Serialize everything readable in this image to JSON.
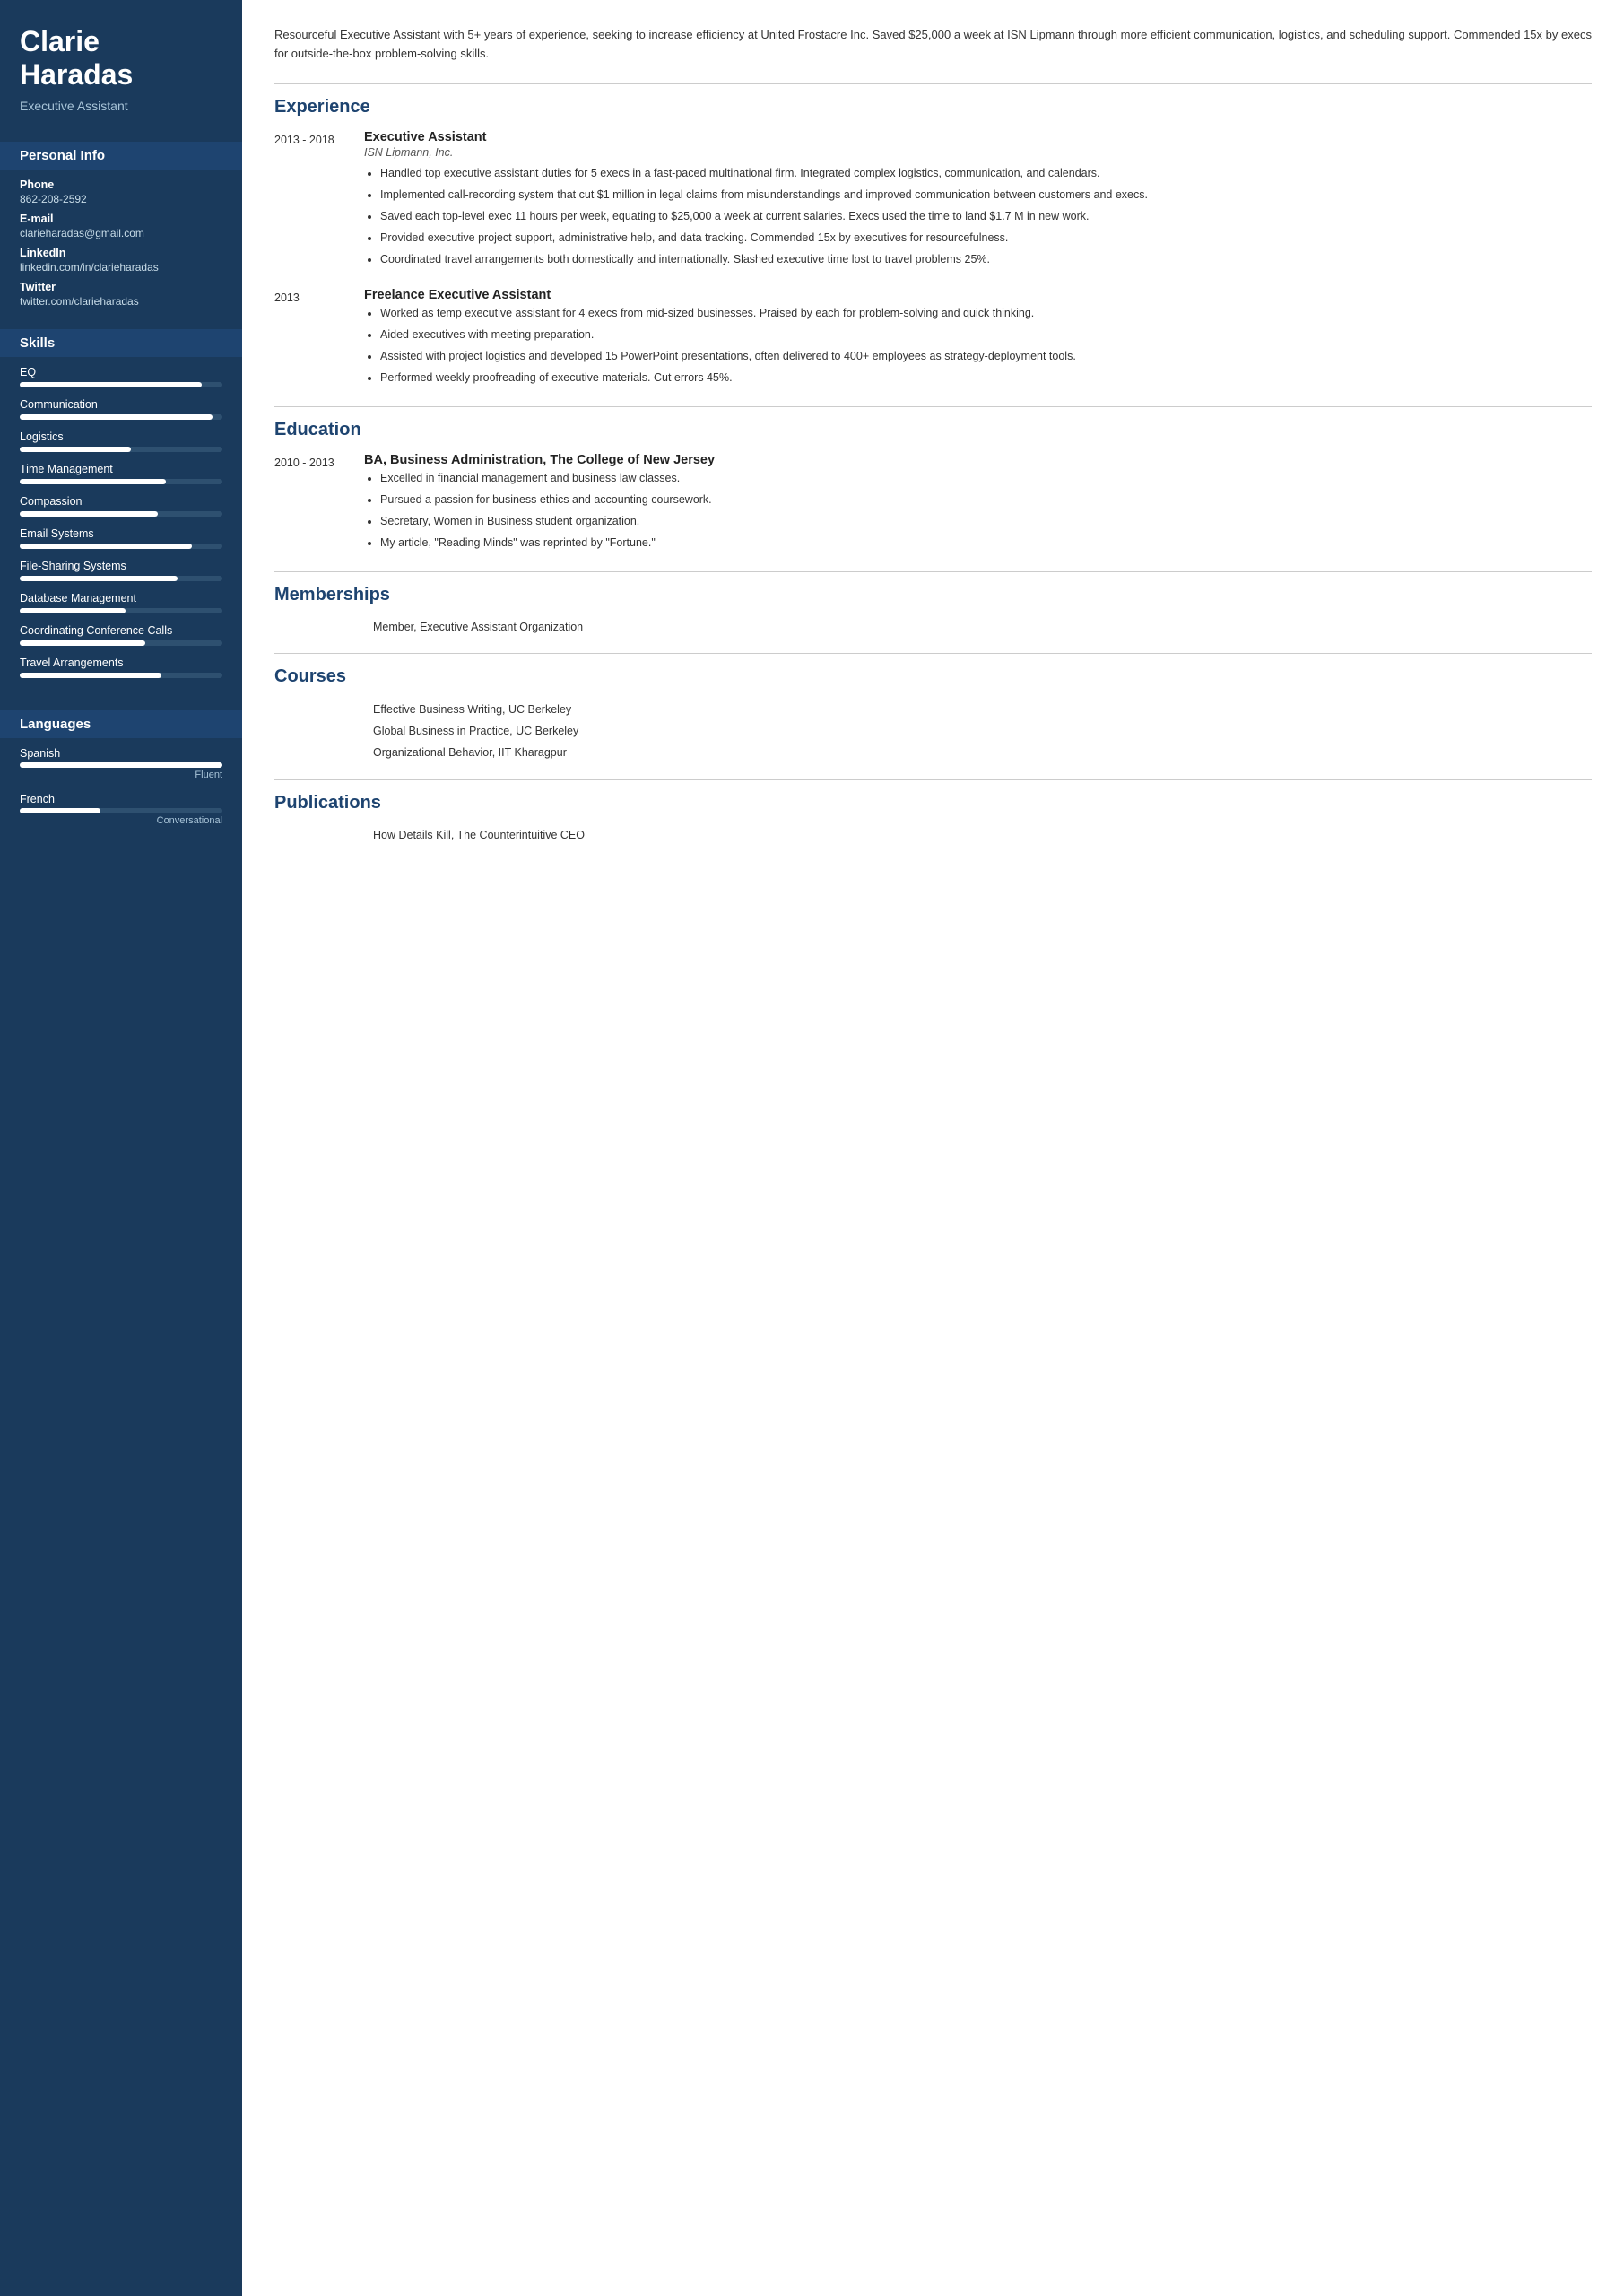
{
  "sidebar": {
    "name_line1": "Clarie",
    "name_line2": "Haradas",
    "title": "Executive Assistant",
    "sections": {
      "personal_info": {
        "label": "Personal Info",
        "fields": [
          {
            "label": "Phone",
            "value": "862-208-2592"
          },
          {
            "label": "E-mail",
            "value": "clarieharadas@gmail.com"
          },
          {
            "label": "LinkedIn",
            "value": "linkedin.com/in/clarieharadas"
          },
          {
            "label": "Twitter",
            "value": "twitter.com/clarieharadas"
          }
        ]
      },
      "skills": {
        "label": "Skills",
        "items": [
          {
            "name": "EQ",
            "percent": 90
          },
          {
            "name": "Communication",
            "percent": 95
          },
          {
            "name": "Logistics",
            "percent": 55
          },
          {
            "name": "Time Management",
            "percent": 72
          },
          {
            "name": "Compassion",
            "percent": 68
          },
          {
            "name": "Email Systems",
            "percent": 85
          },
          {
            "name": "File-Sharing Systems",
            "percent": 78
          },
          {
            "name": "Database Management",
            "percent": 52
          },
          {
            "name": "Coordinating Conference Calls",
            "percent": 62
          },
          {
            "name": "Travel Arrangements",
            "percent": 70
          }
        ]
      },
      "languages": {
        "label": "Languages",
        "items": [
          {
            "name": "Spanish",
            "percent": 100,
            "level": "Fluent"
          },
          {
            "name": "French",
            "percent": 40,
            "level": "Conversational"
          }
        ]
      }
    }
  },
  "main": {
    "summary": "Resourceful Executive Assistant with 5+ years of experience, seeking to increase efficiency at United Frostacre Inc. Saved $25,000 a week at ISN Lipmann through more efficient communication, logistics, and scheduling support. Commended 15x by execs for outside-the-box problem-solving skills.",
    "experience": {
      "label": "Experience",
      "entries": [
        {
          "date": "2013 - 2018",
          "title": "Executive Assistant",
          "company": "ISN Lipmann, Inc.",
          "bullets": [
            "Handled top executive assistant duties for 5 execs in a fast-paced multinational firm. Integrated complex logistics, communication, and calendars.",
            "Implemented call-recording system that cut $1 million in legal claims from misunderstandings and improved communication between customers and execs.",
            "Saved each top-level exec 11 hours per week, equating to $25,000 a week at current salaries. Execs used the time to land $1.7 M in new work.",
            "Provided executive project support, administrative help, and data tracking. Commended 15x by executives for resourcefulness.",
            "Coordinated travel arrangements both domestically and internationally. Slashed executive time lost to travel problems 25%."
          ]
        },
        {
          "date": "2013",
          "title": "Freelance Executive Assistant",
          "company": "",
          "bullets": [
            "Worked as temp executive assistant for 4 execs from mid-sized businesses. Praised by each for problem-solving and quick thinking.",
            "Aided executives with meeting preparation.",
            "Assisted with project logistics and developed 15 PowerPoint presentations, often delivered to 400+ employees as strategy-deployment tools.",
            "Performed weekly proofreading of executive materials. Cut errors 45%."
          ]
        }
      ]
    },
    "education": {
      "label": "Education",
      "entries": [
        {
          "date": "2010 - 2013",
          "title": "BA, Business Administration, The College of New Jersey",
          "company": "",
          "bullets": [
            "Excelled in financial management and business law classes.",
            "Pursued a passion for business ethics and accounting coursework.",
            "Secretary, Women in Business student organization.",
            "My article, \"Reading Minds\" was reprinted by \"Fortune.\""
          ]
        }
      ]
    },
    "memberships": {
      "label": "Memberships",
      "items": [
        "Member, Executive Assistant Organization"
      ]
    },
    "courses": {
      "label": "Courses",
      "items": [
        "Effective Business Writing, UC Berkeley",
        "Global Business in Practice, UC Berkeley",
        "Organizational Behavior, IIT Kharagpur"
      ]
    },
    "publications": {
      "label": "Publications",
      "items": [
        "How Details Kill, The Counterintuitive CEO"
      ]
    }
  }
}
